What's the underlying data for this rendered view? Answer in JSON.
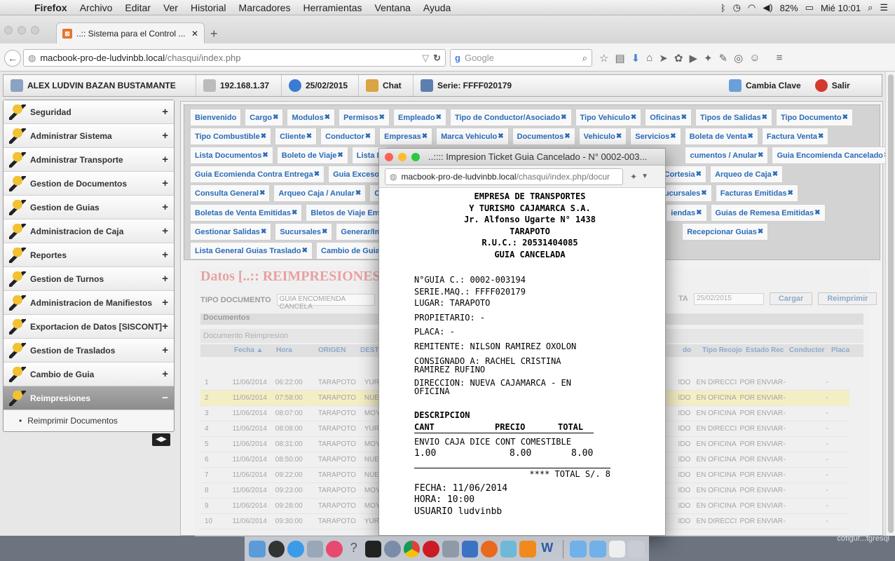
{
  "mac_menu": {
    "apple": "",
    "items": [
      "Firefox",
      "Archivo",
      "Editar",
      "Ver",
      "Historial",
      "Marcadores",
      "Herramientas",
      "Ventana",
      "Ayuda"
    ],
    "battery": "82%",
    "clock": "Mié 10:01"
  },
  "browser": {
    "tab_title": "..:: Sistema para el Control ...",
    "url_host": "macbook-pro-de-ludvinbb.local",
    "url_path": "/chasqui/index.php",
    "search_placeholder": "Google"
  },
  "header": {
    "user": "ALEX LUDVIN BAZAN BUSTAMANTE",
    "ip": "192.168.1.37",
    "date": "25/02/2015",
    "chat": "Chat",
    "serie": "Serie: FFFF020179",
    "change_key": "Cambia Clave",
    "logout": "Salir"
  },
  "sidebar": {
    "items": [
      {
        "label": "Seguridad",
        "sign": "+"
      },
      {
        "label": "Administrar Sistema",
        "sign": "+"
      },
      {
        "label": "Administrar Transporte",
        "sign": "+"
      },
      {
        "label": "Gestion de Documentos",
        "sign": "+"
      },
      {
        "label": "Gestion de Guias",
        "sign": "+"
      },
      {
        "label": "Administracion de Caja",
        "sign": "+"
      },
      {
        "label": "Reportes",
        "sign": "+"
      },
      {
        "label": "Gestion de Turnos",
        "sign": "+"
      },
      {
        "label": "Administracion de Manifiestos",
        "sign": "+"
      },
      {
        "label": "Exportacion de Datos [SISCONT]",
        "sign": "+"
      },
      {
        "label": "Gestion de Traslados",
        "sign": "+"
      },
      {
        "label": "Cambio de Guia",
        "sign": "+"
      },
      {
        "label": "Reimpresiones",
        "sign": "−"
      }
    ],
    "sub_item": "Reimprimir Documentos"
  },
  "tabs": {
    "row1": [
      "Bienvenido",
      "Cargo",
      "Modulos",
      "Permisos",
      "Empleado",
      "Tipo de Conductor/Asociado",
      "Tipo Vehiculo",
      "Oficinas",
      "Tipos de Salidas",
      "Tipo Documento"
    ],
    "row2": [
      "Tipo Combustible",
      "Cliente",
      "Conductor",
      "Empresas",
      "Marca Vehiculo",
      "Documentos",
      "Vehiculo",
      "Servicios",
      "Boleta de Venta",
      "Factura Venta"
    ],
    "row3": [
      "Lista Documentos",
      "Boleto de Viaje",
      "Lista D",
      "cumentos / Anular",
      "Guia Encomienda Cancelado"
    ],
    "row4": [
      "Guia Ecomienda Contra Entrega",
      "Guia Exceso",
      "Guia Cortesia",
      "Arqueo de Caja"
    ],
    "row5": [
      "Consulta General",
      "Arqueo Caja / Anular",
      "Co",
      "ucursales",
      "Facturas Emitidas"
    ],
    "row6": [
      "Boletas de Venta Emitidas",
      "Bletos de Viaje Emit",
      "iendas",
      "Guias de Remesa Emitidas"
    ],
    "row7": [
      "Gestionar Salidas",
      "Sucursales",
      "Generar/Imp",
      "Recepcionar Guias"
    ],
    "row8": [
      "Lista General Guias Traslado",
      "Cambio de Guia"
    ]
  },
  "panel": {
    "title": "Datos [..:: REIMPRESIONES",
    "tipo_label": "TIPO DOCUMENTO",
    "tipo_value": "GUIA ENCOMIENDA CANCELA",
    "fecha_label": "TA",
    "fecha_value": "25/02/2015",
    "btn_cargar": "Cargar",
    "btn_reimprimir": "Reimprimir",
    "docs_label": "Documentos",
    "grid_title": "Documento Reimpresion",
    "columns": [
      "Fecha ▲",
      "Hora",
      "ORIGEN",
      "DESTI",
      "do",
      "Tipo Recojo",
      "Estado Rec",
      "Conductor",
      "Placa"
    ],
    "rows": [
      {
        "n": "1",
        "fecha": "11/06/2014",
        "hora": "06:22:00",
        "origen": "TARAPOTO",
        "dest": "YURIMA",
        "estado": "IDO",
        "recojo": "EN DIRECCI",
        "er": "POR ENVIAR",
        "c": "-",
        "p": "-"
      },
      {
        "n": "2",
        "fecha": "11/06/2014",
        "hora": "07:58:00",
        "origen": "TARAPOTO",
        "dest": "NUEVA",
        "estado": "IDO",
        "recojo": "EN OFICINA",
        "er": "POR ENVIAR",
        "c": "-",
        "p": "-"
      },
      {
        "n": "3",
        "fecha": "11/06/2014",
        "hora": "08:07:00",
        "origen": "TARAPOTO",
        "dest": "MOYOBA",
        "estado": "IDO",
        "recojo": "EN OFICINA",
        "er": "POR ENVIAR",
        "c": "-",
        "p": "-"
      },
      {
        "n": "4",
        "fecha": "11/06/2014",
        "hora": "08:08:00",
        "origen": "TARAPOTO",
        "dest": "YURIMA",
        "estado": "IDO",
        "recojo": "EN DIRECCI",
        "er": "POR ENVIAR",
        "c": "-",
        "p": "-"
      },
      {
        "n": "5",
        "fecha": "11/06/2014",
        "hora": "08:31:00",
        "origen": "TARAPOTO",
        "dest": "MOYOBA",
        "estado": "IDO",
        "recojo": "EN OFICINA",
        "er": "POR ENVIAR",
        "c": "-",
        "p": "-"
      },
      {
        "n": "6",
        "fecha": "11/06/2014",
        "hora": "08:50:00",
        "origen": "TARAPOTO",
        "dest": "NUEVA",
        "estado": "IDO",
        "recojo": "EN OFICINA",
        "er": "POR ENVIAR",
        "c": "-",
        "p": "-"
      },
      {
        "n": "7",
        "fecha": "11/06/2014",
        "hora": "09:22:00",
        "origen": "TARAPOTO",
        "dest": "NUEVA",
        "estado": "IDO",
        "recojo": "EN OFICINA",
        "er": "POR ENVIAR",
        "c": "-",
        "p": "-"
      },
      {
        "n": "8",
        "fecha": "11/06/2014",
        "hora": "09:23:00",
        "origen": "TARAPOTO",
        "dest": "MOYOBA",
        "estado": "IDO",
        "recojo": "EN OFICINA",
        "er": "POR ENVIAR",
        "c": "-",
        "p": "-"
      },
      {
        "n": "9",
        "fecha": "11/06/2014",
        "hora": "09:28:00",
        "origen": "TARAPOTO",
        "dest": "MOYOBA",
        "estado": "IDO",
        "recojo": "EN OFICINA",
        "er": "POR ENVIAR",
        "c": "-",
        "p": "-"
      },
      {
        "n": "10",
        "fecha": "11/06/2014",
        "hora": "09:30:00",
        "origen": "TARAPOTO",
        "dest": "YURIMA",
        "estado": "IDO",
        "recojo": "EN DIRECCI",
        "er": "POR ENVIAR",
        "c": "-",
        "p": "-"
      }
    ]
  },
  "popup": {
    "title": "..:::: Impresion Ticket Guia Cancelado - N° 0002-003...",
    "url_host": "macbook-pro-de-ludvinbb.local",
    "url_path": "/chasqui/index.php/docur",
    "company1": "EMPRESA DE TRANSPORTES",
    "company2": "Y TURISMO CAJAMARCA S.A.",
    "address": "Jr. Alfonso Ugarte N° 1438",
    "city": "TARAPOTO",
    "ruc": "R.U.C.: 20531404085",
    "doc_type": "GUIA CANCELADA",
    "guia": "N°GUIA C.: 0002-003194",
    "serie": "SERIE.MAQ.: FFFF020179",
    "lugar": "LUGAR: TARAPOTO",
    "propietario": "PROPIETARIO: -",
    "placa": "PLACA: -",
    "remitente": "REMITENTE: NILSON RAMIREZ OXOLON",
    "consignado1": "CONSIGNADO A: RACHEL CRISTINA",
    "consignado2": "RAMIREZ RUFINO",
    "direccion1": "DIRECCION: NUEVA CAJAMARCA - EN",
    "direccion2": "OFICINA",
    "desc_title": "DESCRIPCION",
    "col_cant": "CANT",
    "col_precio": "PRECIO",
    "col_total": "TOTAL",
    "item_desc": "ENVIO CAJA DICE CONT COMESTIBLE",
    "item_cant": "1.00",
    "item_precio": "8.00",
    "item_total": "8.00",
    "total_line": "**** TOTAL S/. 8",
    "fecha": "FECHA: 11/06/2014",
    "hora": "HORA: 10:00",
    "usuario": "USUARIO ludvinbb"
  },
  "dock": {
    "status_right": "cofigur...tgresql"
  }
}
